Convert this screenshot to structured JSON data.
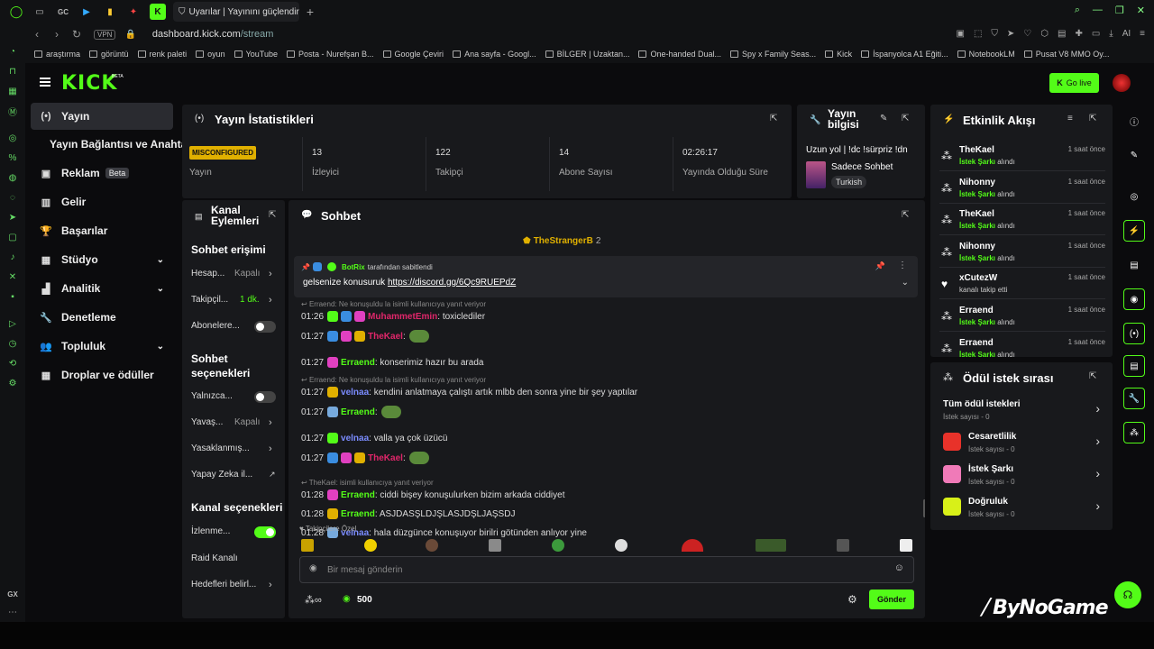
{
  "browser": {
    "tab_title": "Uyarılar | Yayınını güçlendir",
    "url_host": "dashboard.kick.com",
    "url_path": "/stream",
    "vpn": "VPN",
    "ai_label": "AI",
    "tab_gc": "GC",
    "sidebar_gx": "GX",
    "bookmarks": [
      "araştırma",
      "görüntü",
      "renk paleti",
      "oyun",
      "YouTube",
      "Posta - Nurefşan B...",
      "Google Çeviri",
      "Ana sayfa - Googl...",
      "BİLGER | Uzaktan...",
      "One-handed Dual...",
      "Spy x Family Seas...",
      "Kick",
      "İspanyolca A1 Eğiti...",
      "NotebookLM",
      "Pusat V8 MMO Oy..."
    ]
  },
  "header": {
    "logo": "KICK",
    "beta": "BETA",
    "go_live": "Go live"
  },
  "sidenav": {
    "items": [
      {
        "label": "Yayın"
      },
      {
        "label": "Yayın Bağlantısı ve Anahtarı"
      },
      {
        "label": "Reklam",
        "badge": "Beta"
      },
      {
        "label": "Gelir"
      },
      {
        "label": "Başarılar"
      },
      {
        "label": "Stüdyo"
      },
      {
        "label": "Analitik"
      },
      {
        "label": "Denetleme"
      },
      {
        "label": "Topluluk"
      },
      {
        "label": "Droplar ve ödüller"
      }
    ]
  },
  "stats": {
    "title": "Yayın İstatistikleri",
    "status_badge": "MISCONFIGURED",
    "status_label": "Yayın",
    "cells": [
      {
        "value": "13",
        "label": "İzleyici"
      },
      {
        "value": "122",
        "label": "Takipçi"
      },
      {
        "value": "14",
        "label": "Abone Sayısı"
      },
      {
        "value": "02:26:17",
        "label": "Yayında Olduğu Süre"
      }
    ]
  },
  "stream_info": {
    "title_line1": "Yayın",
    "title_line2": "bilgisi",
    "stream_title": "Uzun yol | !dc !sürpriz !dn",
    "category": "Sadece Sohbet",
    "tag": "Turkish"
  },
  "channel_actions": {
    "title_line1": "Kanal",
    "title_line2": "Eylemleri",
    "chat_access": "Sohbet erişimi",
    "rows1": [
      {
        "label": "Hesap...",
        "value": "Kapalı"
      },
      {
        "label": "Takipçil...",
        "value": "1 dk."
      },
      {
        "label": "Abonelere..."
      }
    ],
    "chat_options_line1": "Sohbet",
    "chat_options_line2": "seçenekleri",
    "rows2": [
      {
        "label": "Yalnızca..."
      },
      {
        "label": "Yavaş...",
        "value": "Kapalı"
      },
      {
        "label": "Yasaklanmış..."
      },
      {
        "label": "Yapay Zeka il..."
      }
    ],
    "channel_options": "Kanal seçenekleri",
    "rows3": [
      {
        "label": "İzlenme..."
      },
      {
        "label": "Raid Kanalı"
      },
      {
        "label": "Hedefleri belirl..."
      }
    ]
  },
  "chat": {
    "title": "Sohbet",
    "top_user": "TheStrangerB",
    "top_count": "2",
    "pinned": {
      "by_user": "BotRix",
      "by_text": "tarafından sabitlendi",
      "text": "gelsenize konusuruk",
      "link": "https://discord.gg/6Qc9RUEPdZ"
    },
    "messages": [
      {
        "reply": "Erraend: Ne konuşuldu la isimli kullanıcıya yanıt veriyor",
        "time": "01:26",
        "user": "MuhammetEmin",
        "color": "#e0266a",
        "text": ": toxiclediler"
      },
      {
        "time": "01:27",
        "user": "TheKael",
        "color": "#e0266a",
        "text": ":"
      },
      {
        "time": "01:27",
        "user": "Erraend",
        "color": "#53fc18",
        "text": ": konserimiz hazır bu arada"
      },
      {
        "reply": "Erraend: Ne konuşuldu la isimli kullanıcıya yanıt veriyor",
        "time": "01:27",
        "user": "velnaa",
        "color": "#7b8cff",
        "text": ": kendini anlatmaya çalıştı artık mlbb den sonra yine bir şey yaptılar"
      },
      {
        "time": "01:27",
        "user": "Erraend",
        "color": "#53fc18",
        "text": ":"
      },
      {
        "time": "01:27",
        "user": "velnaa",
        "color": "#7b8cff",
        "text": ": valla ya çok üzücü"
      },
      {
        "time": "01:27",
        "user": "TheKael",
        "color": "#e0266a",
        "text": ":"
      },
      {
        "reply": "TheKael: isimli kullanıcıya yanıt veriyor",
        "time": "01:28",
        "user": "Erraend",
        "color": "#53fc18",
        "text": ": ciddi bişey konuşulurken bizim arkada ciddiyet"
      },
      {
        "time": "01:28",
        "user": "Erraend",
        "color": "#53fc18",
        "text": ": ASJDASŞLDJŞLASJDŞLJAŞSDJ"
      },
      {
        "time": "01:28",
        "user": "velnaa",
        "color": "#7b8cff",
        "text": ": hala düzgünce konuşuyor birilri götünden anlıyor yine"
      }
    ],
    "follower_only": "Takipçilere Özel",
    "input_placeholder": "Bir mesaj gönderin",
    "points": "500",
    "send": "Gönder"
  },
  "activity": {
    "title": "Etkinlik Akışı",
    "events": [
      {
        "user": "TheKael",
        "action_strong": "İstek Şarkı",
        "action": "alındı",
        "time": "1 saat önce"
      },
      {
        "user": "Nihonny",
        "action_strong": "İstek Şarkı",
        "action": "alındı",
        "time": "1 saat önce"
      },
      {
        "user": "TheKael",
        "action_strong": "İstek Şarkı",
        "action": "alındı",
        "time": "1 saat önce"
      },
      {
        "user": "Nihonny",
        "action_strong": "İstek Şarkı",
        "action": "alındı",
        "time": "1 saat önce"
      },
      {
        "user": "xCutezW",
        "action_strong": "",
        "action": "kanalı takip etti",
        "time": "1 saat önce"
      },
      {
        "user": "Erraend",
        "action_strong": "İstek Şarkı",
        "action": "alındı",
        "time": "1 saat önce"
      },
      {
        "user": "Erraend",
        "action_strong": "İstek Şarkı",
        "action": "alındı",
        "time": "1 saat önce"
      }
    ]
  },
  "rewards": {
    "title": "Ödül istek sırası",
    "items": [
      {
        "name": "Tüm ödül istekleri",
        "sub": "İstek sayısı - 0",
        "color": ""
      },
      {
        "name": "Cesaretlilik",
        "sub": "İstek sayısı - 0",
        "color": "#e8322a"
      },
      {
        "name": "İstek Şarkı",
        "sub": "İstek sayısı - 0",
        "color": "#f07ab8"
      },
      {
        "name": "Doğruluk",
        "sub": "İstek sayısı - 0",
        "color": "#d8f018"
      }
    ]
  },
  "watermark": "ByNoGame",
  "colors": {
    "accent": "#53fc18",
    "panel": "#18191c",
    "bg": "#0b0b0d"
  }
}
